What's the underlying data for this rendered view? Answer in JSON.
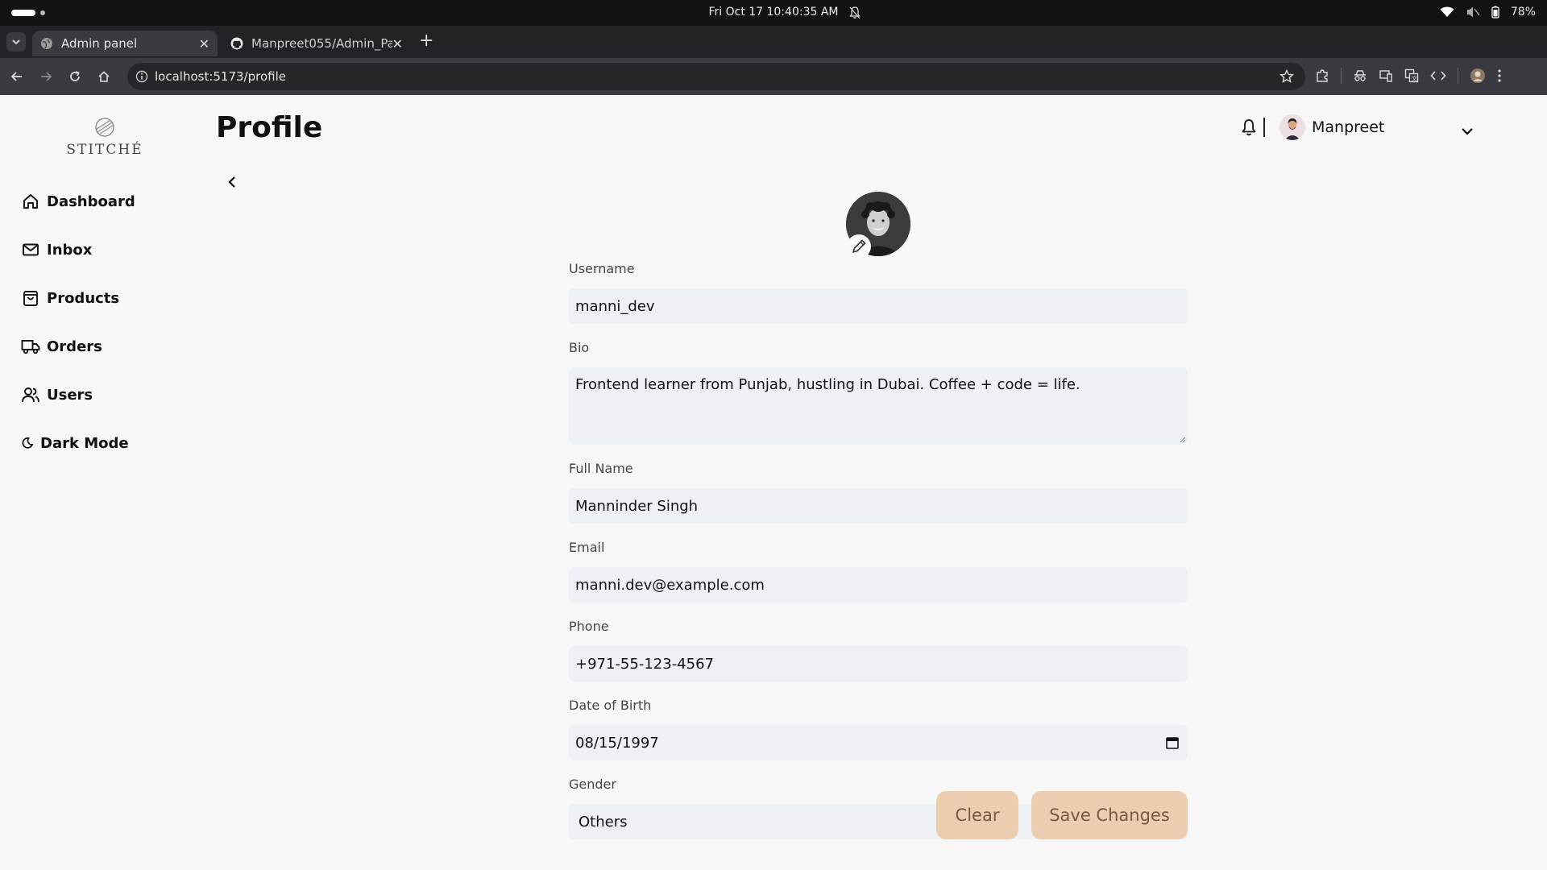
{
  "os": {
    "clock": "Fri Oct 17  10:40:35 AM",
    "battery": "78%"
  },
  "browser": {
    "tabs": [
      {
        "title": "Admin panel",
        "icon": "globe-icon",
        "active": true
      },
      {
        "title": "Manpreet055/Admin_Pa",
        "icon": "github-icon",
        "active": false
      }
    ],
    "url": "localhost:5173/profile"
  },
  "app": {
    "logo_text": "STITCHÉ",
    "page_title": "Profile",
    "sidebar": [
      {
        "label": "Dashboard",
        "icon": "home-icon"
      },
      {
        "label": "Inbox",
        "icon": "mail-icon"
      },
      {
        "label": "Products",
        "icon": "bag-icon"
      },
      {
        "label": "Orders",
        "icon": "truck-icon"
      },
      {
        "label": "Users",
        "icon": "users-icon"
      },
      {
        "label": "Dark Mode",
        "icon": "moon-icon"
      }
    ],
    "user": {
      "name": "Manpreet"
    }
  },
  "profile_form": {
    "username": {
      "label": "Username",
      "value": "manni_dev"
    },
    "bio": {
      "label": "Bio",
      "value": "Frontend learner from Punjab, hustling in Dubai. Coffee + code = life."
    },
    "full_name": {
      "label": "Full Name",
      "value": "Manninder Singh"
    },
    "email": {
      "label": "Email",
      "value": "manni.dev@example.com"
    },
    "phone": {
      "label": "Phone",
      "value": "+971-55-123-4567"
    },
    "dob": {
      "label": "Date of Birth",
      "value": "08/15/1997"
    },
    "gender": {
      "label": "Gender",
      "value": "Others"
    },
    "clear_label": "Clear",
    "save_label": "Save Changes"
  },
  "colors": {
    "accent_button": "#edcdb0",
    "accent_button_text": "#7a5a3e",
    "field_bg": "#edf0f5"
  }
}
